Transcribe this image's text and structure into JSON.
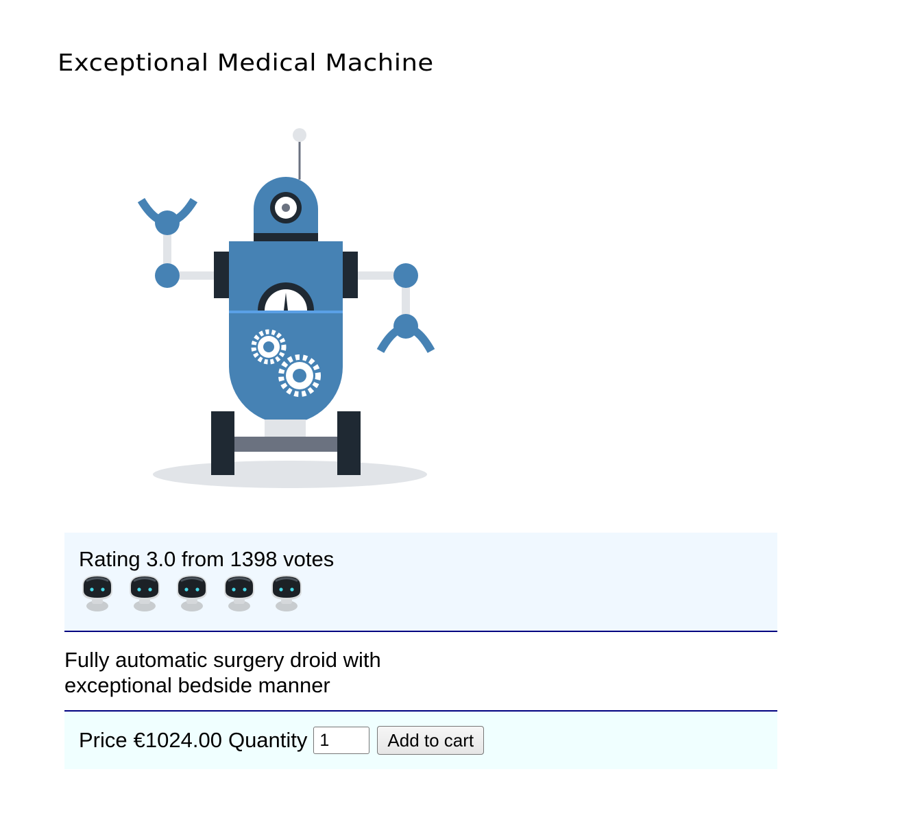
{
  "product": {
    "title": "Exceptional Medical Machine",
    "image_name": "robot-illustration",
    "rating": {
      "text": "Rating 3.0 from 1398 votes",
      "value": 3.0,
      "votes": 1398,
      "max": 5,
      "icon": "robot-head-icon"
    },
    "description": "Fully automatic surgery droid with exceptional bedside manner",
    "purchase": {
      "price_label": "Price",
      "price_value": "€1024.00",
      "quantity_label": "Quantity",
      "quantity_value": "1",
      "add_to_cart_label": "Add to cart"
    }
  },
  "colors": {
    "robot_blue": "#4682b4",
    "robot_dark": "#1f2933",
    "robot_light": "#e1e4e8",
    "rating_bg": "#f0f8ff",
    "purchase_bg": "#f0ffff",
    "rule": "#000080"
  }
}
